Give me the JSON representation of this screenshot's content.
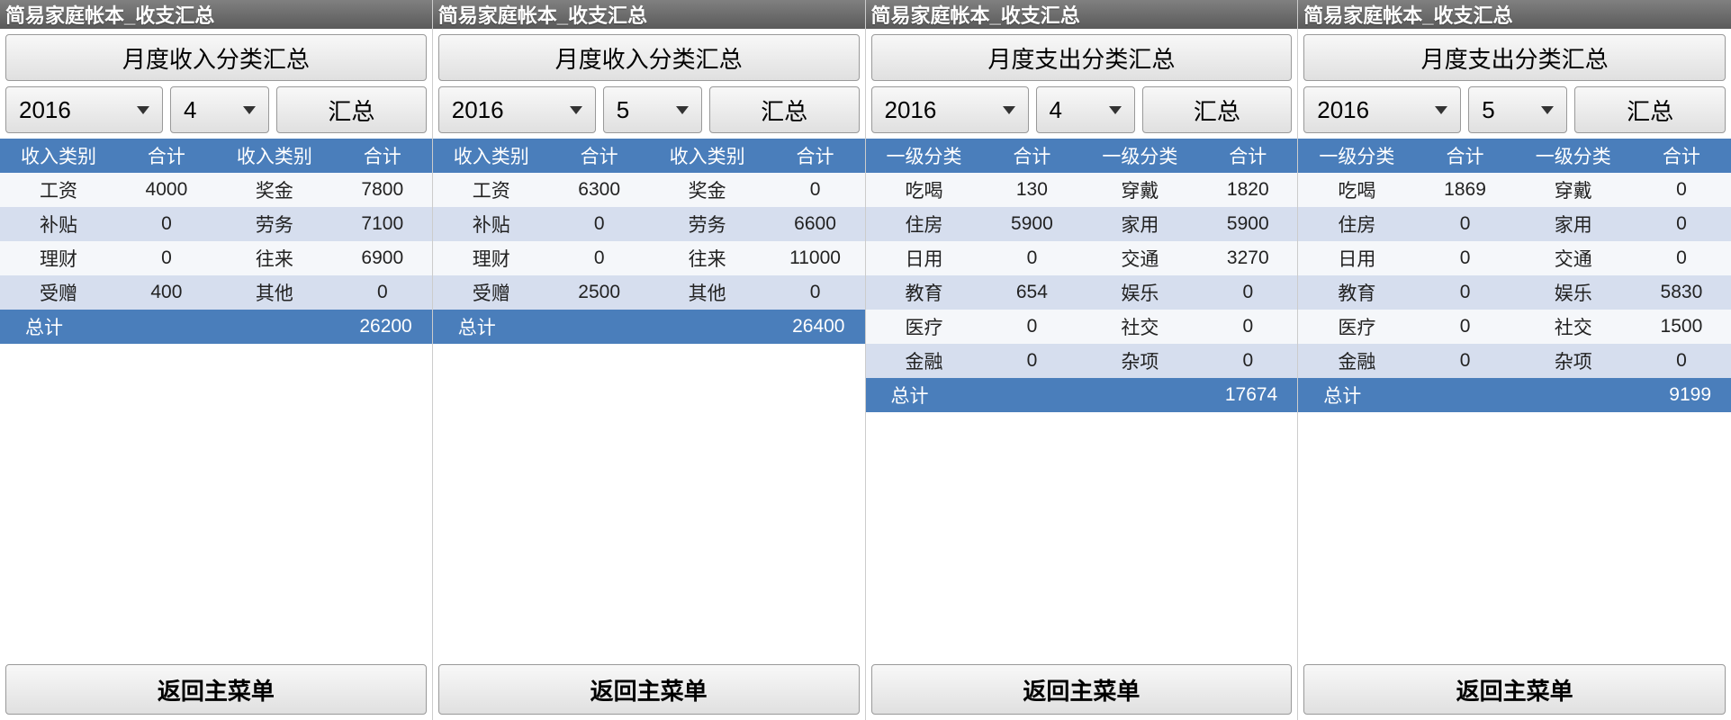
{
  "common": {
    "title": "简易家庭帐本_收支汇总",
    "summarize_btn": "汇总",
    "back_btn": "返回主菜单",
    "year": "2016",
    "total_label": "总计"
  },
  "panels": [
    {
      "category_btn": "月度收入分类汇总",
      "month": "4",
      "headers": [
        "收入类别",
        "合计",
        "收入类别",
        "合计"
      ],
      "rows": [
        [
          "工资",
          "4000",
          "奖金",
          "7800"
        ],
        [
          "补贴",
          "0",
          "劳务",
          "7100"
        ],
        [
          "理财",
          "0",
          "往来",
          "6900"
        ],
        [
          "受赠",
          "400",
          "其他",
          "0"
        ]
      ],
      "total": "26200"
    },
    {
      "category_btn": "月度收入分类汇总",
      "month": "5",
      "headers": [
        "收入类别",
        "合计",
        "收入类别",
        "合计"
      ],
      "rows": [
        [
          "工资",
          "6300",
          "奖金",
          "0"
        ],
        [
          "补贴",
          "0",
          "劳务",
          "6600"
        ],
        [
          "理财",
          "0",
          "往来",
          "11000"
        ],
        [
          "受赠",
          "2500",
          "其他",
          "0"
        ]
      ],
      "total": "26400"
    },
    {
      "category_btn": "月度支出分类汇总",
      "month": "4",
      "headers": [
        "一级分类",
        "合计",
        "一级分类",
        "合计"
      ],
      "rows": [
        [
          "吃喝",
          "130",
          "穿戴",
          "1820"
        ],
        [
          "住房",
          "5900",
          "家用",
          "5900"
        ],
        [
          "日用",
          "0",
          "交通",
          "3270"
        ],
        [
          "教育",
          "654",
          "娱乐",
          "0"
        ],
        [
          "医疗",
          "0",
          "社交",
          "0"
        ],
        [
          "金融",
          "0",
          "杂项",
          "0"
        ]
      ],
      "total": "17674"
    },
    {
      "category_btn": "月度支出分类汇总",
      "month": "5",
      "headers": [
        "一级分类",
        "合计",
        "一级分类",
        "合计"
      ],
      "rows": [
        [
          "吃喝",
          "1869",
          "穿戴",
          "0"
        ],
        [
          "住房",
          "0",
          "家用",
          "0"
        ],
        [
          "日用",
          "0",
          "交通",
          "0"
        ],
        [
          "教育",
          "0",
          "娱乐",
          "5830"
        ],
        [
          "医疗",
          "0",
          "社交",
          "1500"
        ],
        [
          "金融",
          "0",
          "杂项",
          "0"
        ]
      ],
      "total": "9199"
    }
  ]
}
